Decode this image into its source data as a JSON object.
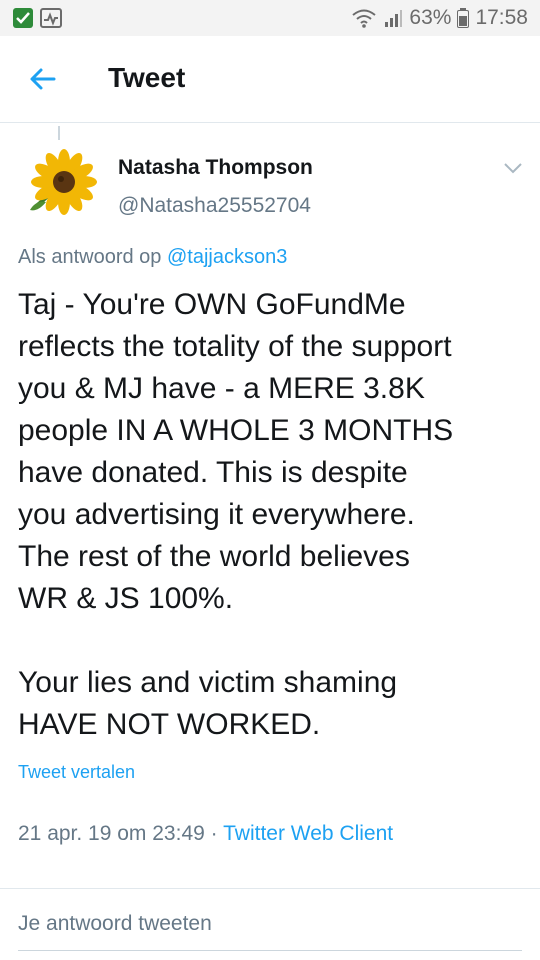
{
  "status_bar": {
    "battery": "63%",
    "time": "17:58"
  },
  "header": {
    "back_icon": "arrow-left-icon",
    "title": "Tweet"
  },
  "tweet": {
    "author_name": "Natasha Thompson",
    "author_handle": "@Natasha25552704",
    "replying_prefix": "Als antwoord op",
    "replying_to": "@tajjackson3",
    "text": "Taj - You're OWN GoFundMe\nreflects the totality of the support\nyou & MJ have - a MERE 3.8K\npeople IN A WHOLE 3 MONTHS\nhave donated. This is despite\nyou advertising it everywhere.\nThe rest of the world believes\nWR & JS 100%.\n\nYour lies and victim shaming\nHAVE NOT WORKED.",
    "translate_label": "Tweet vertalen",
    "timestamp": "21 apr. 19 om 23:49",
    "separator": " · ",
    "client": "Twitter Web Client"
  },
  "reply": {
    "placeholder": "Je antwoord tweeten"
  },
  "colors": {
    "accent": "#1da1f2",
    "secondary_text": "#657786"
  }
}
